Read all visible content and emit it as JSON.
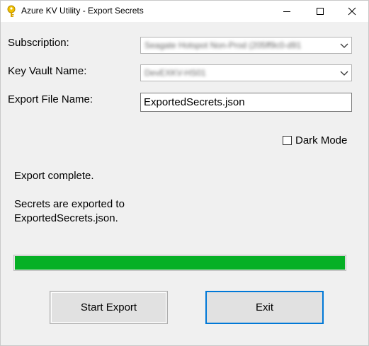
{
  "window": {
    "title": "Azure KV Utility - Export Secrets",
    "icon": "key-icon"
  },
  "form": {
    "subscription_label": "Subscription:",
    "subscription_value": "Seagate Hotspot Non-Prod (205ff9c0-d91",
    "keyvault_label": "Key Vault Name:",
    "keyvault_value": "DevEXKV-HS01",
    "filename_label": "Export File Name:",
    "filename_value": "ExportedSecrets.json",
    "darkmode_label": "Dark Mode",
    "darkmode_checked": false
  },
  "status": {
    "line1": "Export complete.",
    "line2": "Secrets are exported to",
    "line3": "ExportedSecrets.json."
  },
  "progress": {
    "percent": 100,
    "color": "#06b025"
  },
  "buttons": {
    "start_label": "Start Export",
    "exit_label": "Exit"
  },
  "colors": {
    "accent": "#0078d7",
    "window_bg": "#f0f0f0"
  }
}
